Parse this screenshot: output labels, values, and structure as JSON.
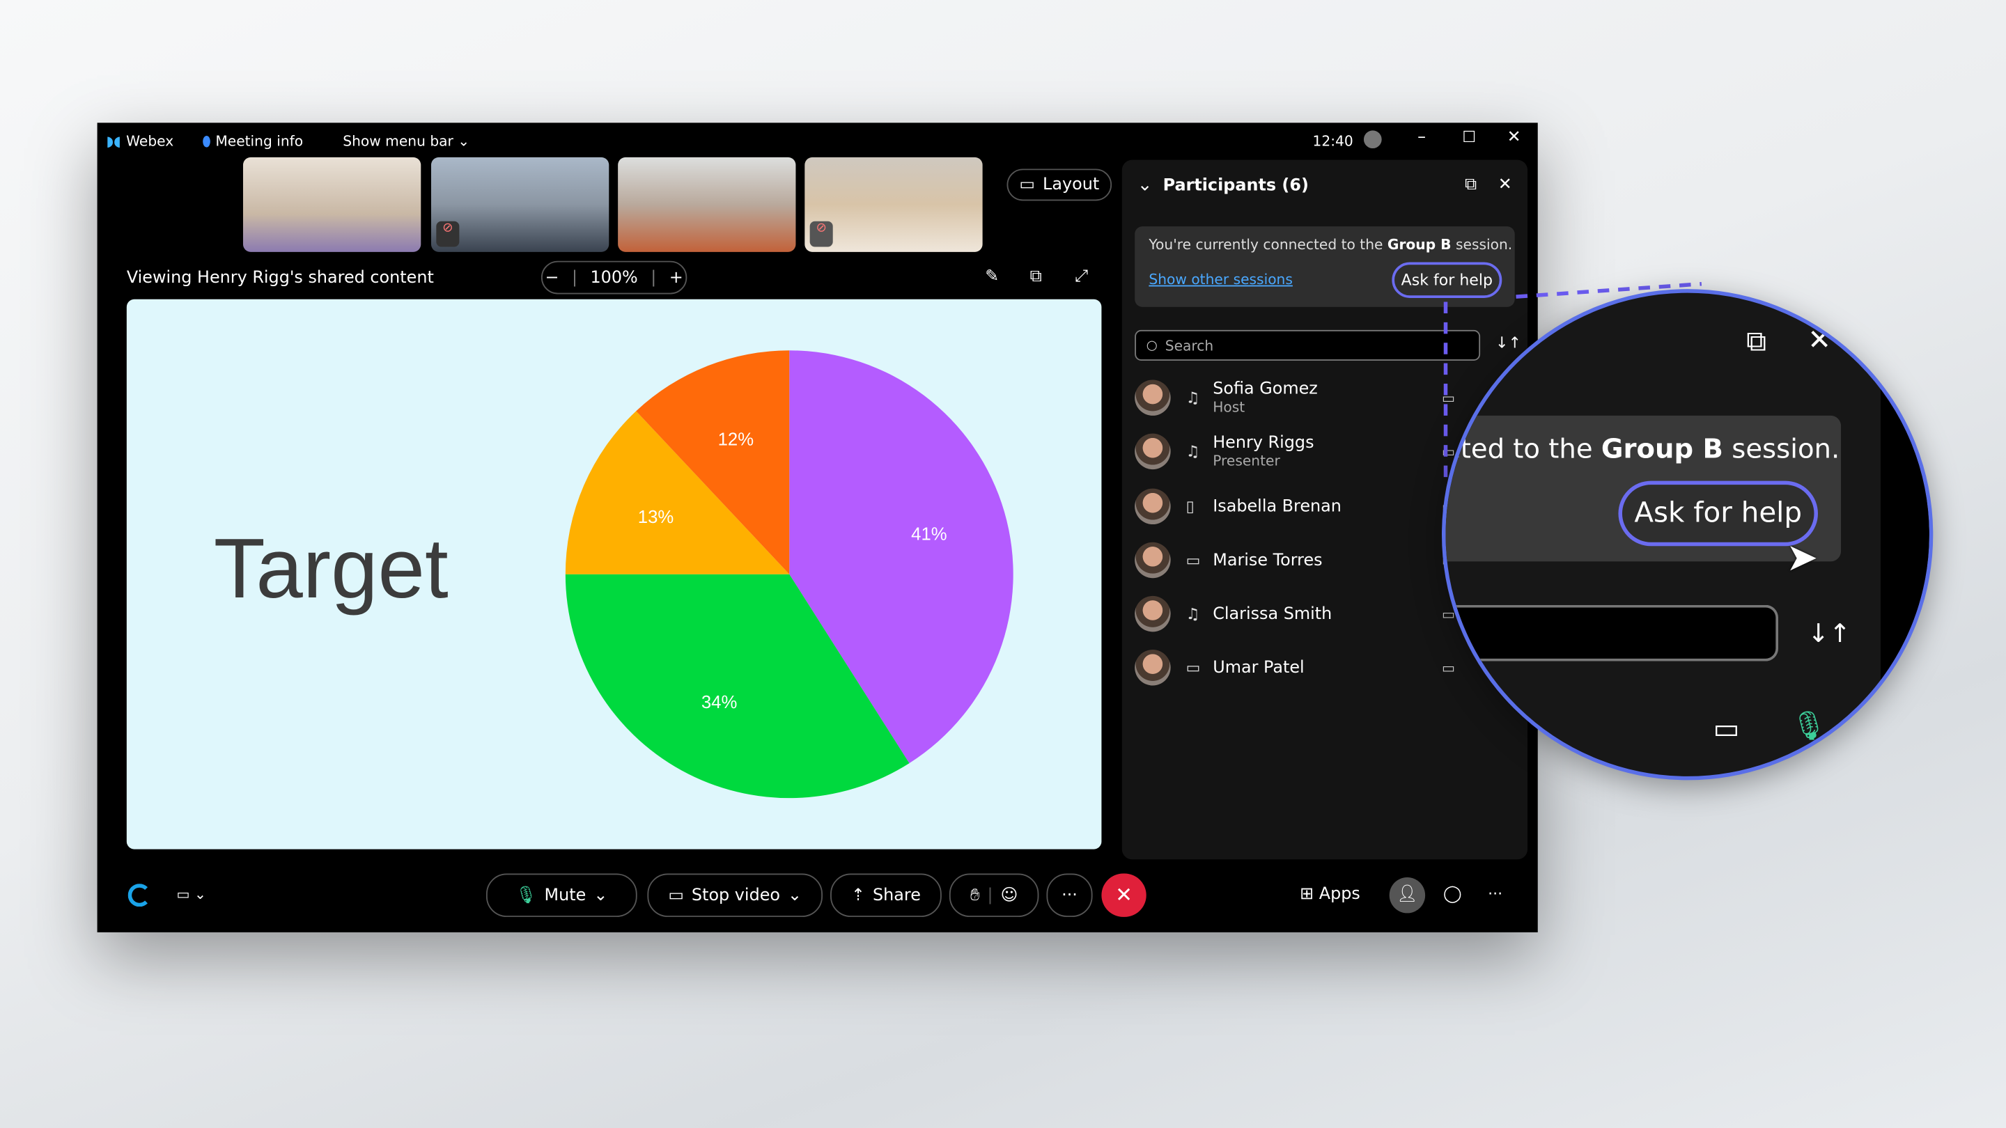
{
  "titlebar": {
    "app": "Webex",
    "meeting_info": "Meeting info",
    "show_menu_bar": "Show menu bar",
    "time": "12:40"
  },
  "stage": {
    "layout_label": "Layout",
    "viewing_text": "Viewing Henry Rigg's shared content",
    "zoom_level": "100%"
  },
  "content": {
    "title": "Target"
  },
  "chart_data": {
    "type": "pie",
    "values": [
      41,
      34,
      13,
      12
    ],
    "labels": [
      "41%",
      "34%",
      "13%",
      "12%"
    ],
    "colors": [
      "#b45cff",
      "#00d93e",
      "#ffb000",
      "#ff6a0a"
    ],
    "start": "top",
    "direction": "clockwise"
  },
  "participants": {
    "title": "Participants (6)",
    "session_prefix": "You're currently connected to the ",
    "session_name": "Group B",
    "session_suffix": " session.",
    "show_other": "Show other sessions",
    "ask_help": "Ask for help",
    "search_placeholder": "Search",
    "list": [
      {
        "name": "Sofia Gomez",
        "role": "Host",
        "device": "headset-icon"
      },
      {
        "name": "Henry Riggs",
        "role": "Presenter",
        "device": "headset-icon"
      },
      {
        "name": "Isabella Brenan",
        "role": "",
        "device": "tablet-icon"
      },
      {
        "name": "Marise Torres",
        "role": "",
        "device": "laptop-icon"
      },
      {
        "name": "Clarissa Smith",
        "role": "",
        "device": "headset-icon"
      },
      {
        "name": "Umar Patel",
        "role": "",
        "device": "laptop-icon"
      }
    ]
  },
  "magnifier": {
    "text_prefix": "cted to the ",
    "session_name": "Group B",
    "text_suffix": " session.",
    "ask_help": "Ask for help"
  },
  "toolbar": {
    "mute": "Mute",
    "stop_video": "Stop video",
    "share": "Share",
    "apps": "Apps",
    "more": "···"
  },
  "colors": {
    "end_call": "#e0203a",
    "accent_link": "#4aa8ff",
    "mic_active": "#3ccf9a"
  }
}
